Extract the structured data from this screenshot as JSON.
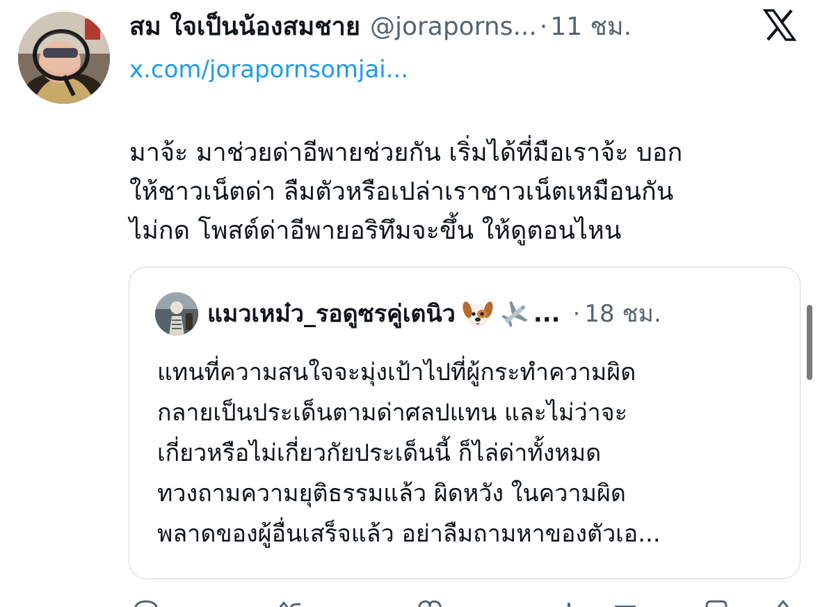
{
  "tweet": {
    "author": {
      "display_name": "สม ใจเป็นน้องสมชาย",
      "handle": "@joraporns...",
      "avatar_icon": "profile-photo"
    },
    "separator": "·",
    "time": "11 ชม.",
    "profile_link": "x.com/jorapornsomjai...",
    "text_lines": [
      "มาจ้ะ มาช่วยด่าอีพายช่วยกัน เริ่มได้ที่มือเราจ้ะ บอก",
      "ให้ชาวเน็ตด่า ลืมตัวหรือเปล่าเราชาวเน็ตเหมือนกัน",
      "ไม่กด โพสต์ด่าอีพายอริทึมจะขึ้น ให้ดูตอนไหน"
    ],
    "platform_icon": "x-logo-icon"
  },
  "quote": {
    "author": {
      "display_name": "แมวเหม๋ว_รอดูซรคู่เตนิว",
      "emoji": [
        "dog-face-emoji",
        "airplane-emoji"
      ],
      "ellipsis": "...",
      "avatar_icon": "profile-photo"
    },
    "separator": "·",
    "time": "18 ชม.",
    "text_lines": [
      "แทนที่ความสนใจจะมุ่งเป้าไปที่ผู้กระทำความผิด",
      "กลายเป็นประเด็นตามด่าศลปแทน และไม่ว่าจะ",
      "เกี่ยวหรือไม่เกี่ยวกัยประเด็นนี้ ก็ไล่ด่าทั้งหมด",
      "ทวงถามความยุติธรรมแล้ว ผิดหวัง ในความผิด",
      "พลาดของผู้อื่นเสร็จแล้ว อย่าลืมถามหาของตัวเอ..."
    ]
  },
  "actions": [
    "reply-icon",
    "retweet-icon",
    "like-icon",
    "views-icon",
    "bookmark-icon",
    "share-icon"
  ],
  "colors": {
    "text": "#0f1419",
    "secondary": "#536471",
    "link": "#1d9bf0",
    "border": "#cfd9de"
  }
}
